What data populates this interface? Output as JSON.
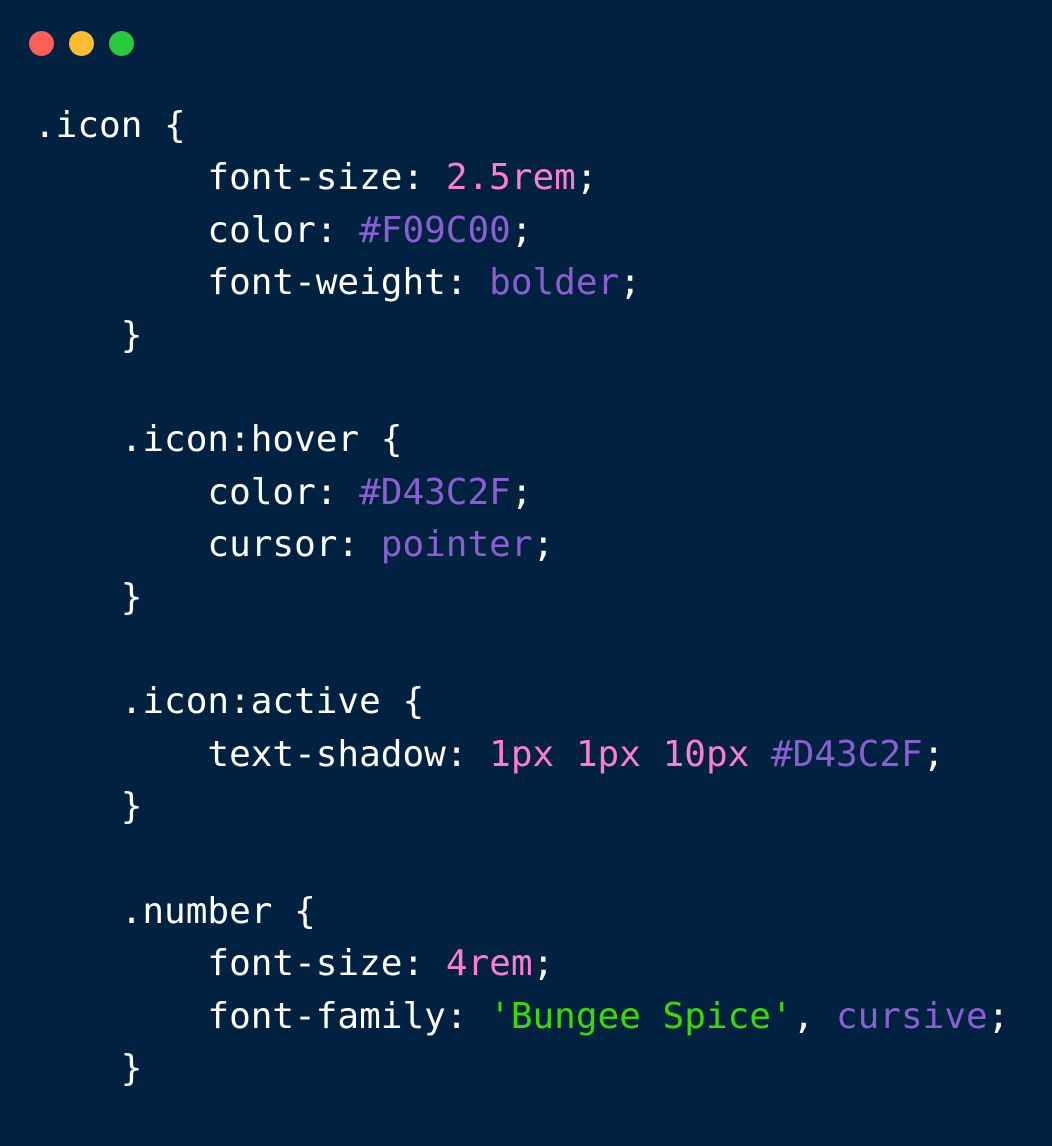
{
  "window": {
    "controls": [
      {
        "name": "close",
        "color": "#ff5f56"
      },
      {
        "name": "minimize",
        "color": "#ffbd2e"
      },
      {
        "name": "maximize",
        "color": "#27c93f"
      }
    ]
  },
  "code": {
    "lines": [
      [
        {
          "t": ".icon {",
          "k": "plain"
        }
      ],
      [
        {
          "t": "        font-size: ",
          "k": "plain"
        },
        {
          "t": "2.5rem",
          "k": "num"
        },
        {
          "t": ";",
          "k": "plain"
        }
      ],
      [
        {
          "t": "        color: ",
          "k": "plain"
        },
        {
          "t": "#F09C00",
          "k": "hex"
        },
        {
          "t": ";",
          "k": "plain"
        }
      ],
      [
        {
          "t": "        font-weight: ",
          "k": "plain"
        },
        {
          "t": "bolder",
          "k": "kw"
        },
        {
          "t": ";",
          "k": "plain"
        }
      ],
      [
        {
          "t": "    }",
          "k": "plain"
        }
      ],
      [
        {
          "t": "",
          "k": "plain"
        }
      ],
      [
        {
          "t": "    .icon:hover {",
          "k": "plain"
        }
      ],
      [
        {
          "t": "        color: ",
          "k": "plain"
        },
        {
          "t": "#D43C2F",
          "k": "hex"
        },
        {
          "t": ";",
          "k": "plain"
        }
      ],
      [
        {
          "t": "        cursor: ",
          "k": "plain"
        },
        {
          "t": "pointer",
          "k": "kw"
        },
        {
          "t": ";",
          "k": "plain"
        }
      ],
      [
        {
          "t": "    }",
          "k": "plain"
        }
      ],
      [
        {
          "t": "",
          "k": "plain"
        }
      ],
      [
        {
          "t": "    .icon:active {",
          "k": "plain"
        }
      ],
      [
        {
          "t": "        text-shadow: ",
          "k": "plain"
        },
        {
          "t": "1px",
          "k": "num"
        },
        {
          "t": " ",
          "k": "plain"
        },
        {
          "t": "1px",
          "k": "num"
        },
        {
          "t": " ",
          "k": "plain"
        },
        {
          "t": "10px",
          "k": "num"
        },
        {
          "t": " ",
          "k": "plain"
        },
        {
          "t": "#D43C2F",
          "k": "hex"
        },
        {
          "t": ";",
          "k": "plain"
        }
      ],
      [
        {
          "t": "    }",
          "k": "plain"
        }
      ],
      [
        {
          "t": "",
          "k": "plain"
        }
      ],
      [
        {
          "t": "    .number {",
          "k": "plain"
        }
      ],
      [
        {
          "t": "        font-size: ",
          "k": "plain"
        },
        {
          "t": "4rem",
          "k": "num"
        },
        {
          "t": ";",
          "k": "plain"
        }
      ],
      [
        {
          "t": "        font-family: ",
          "k": "plain"
        },
        {
          "t": "'Bungee Spice'",
          "k": "str"
        },
        {
          "t": ", ",
          "k": "plain"
        },
        {
          "t": "cursive",
          "k": "kw"
        },
        {
          "t": ";",
          "k": "plain"
        }
      ],
      [
        {
          "t": "    }",
          "k": "plain"
        }
      ]
    ]
  }
}
